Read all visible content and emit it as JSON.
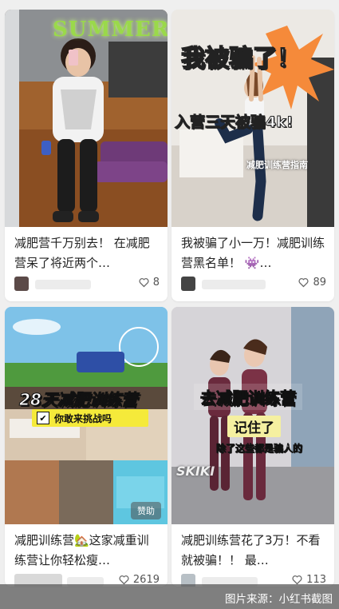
{
  "feed": {
    "cards": [
      {
        "cover_text": "SUMMER",
        "caption": "减肥营千万别去！ 在减肥营呆了将近两个…",
        "likes": "8",
        "colors": {
          "bg": "#6b4a2e",
          "accent": "#9ad94a"
        }
      },
      {
        "cover_text_main": "我被骗了！",
        "cover_text_sub": "入营三天被骗4k!",
        "cover_text_small": "减肥训练营指南",
        "caption": "我被骗了小一万！减肥训练营黑名单！ 👾…",
        "likes": "89",
        "colors": {
          "bg": "#e8e4de",
          "accent": "#f58a3a"
        }
      },
      {
        "cover_text_main": "28天减肥训练营",
        "cover_text_sub": "你敢来挑战吗",
        "sponsor": "赞助",
        "caption": "减肥训练营🏡这家减重训练营让你轻松瘦…",
        "likes": "2619",
        "colors": {
          "bg": "#7ec2e8",
          "accent": "#f5ea3a"
        }
      },
      {
        "cover_text_main": "去减肥训练营",
        "cover_text_sub": "记住了",
        "cover_text_small": "除了这些都是骗人的",
        "cover_brand": "SKIKI",
        "caption": "减肥训练营花了3万！不看就被骗！！ 最…",
        "likes": "113",
        "colors": {
          "bg": "#c9c4cc",
          "accent": "#6a2a3d"
        }
      }
    ]
  },
  "source_label": "图片来源：小红书截图",
  "icons": {
    "like": "heart-outline-icon",
    "checkbox": "check-icon"
  }
}
